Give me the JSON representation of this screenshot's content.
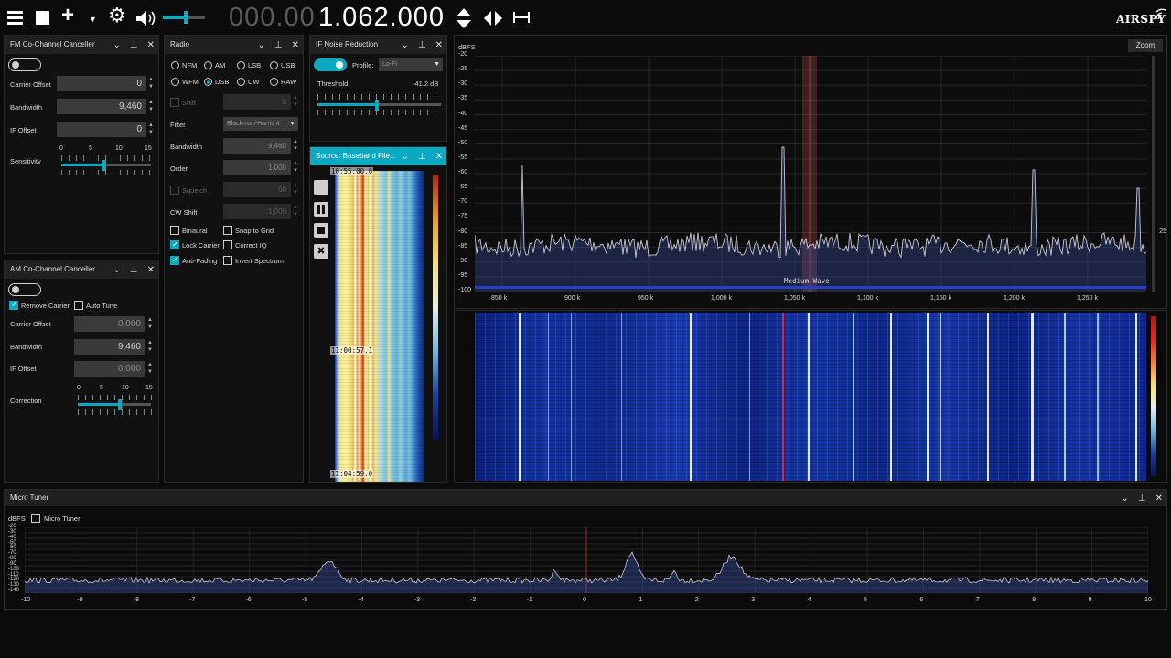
{
  "toolbar": {
    "freq_dim": "000.00",
    "freq_bright": "1.062.000",
    "brand": "AIRSPY",
    "volume_level": 0.55
  },
  "fm_cc": {
    "title": "FM Co-Channel Canceller",
    "carrier_offset_label": "Carrier Offset",
    "carrier_offset": "0",
    "bandwidth_label": "Bandwidth",
    "bandwidth": "9,460",
    "if_offset_label": "IF Offset",
    "if_offset": "0",
    "sensitivity_label": "Sensitivity",
    "ticks": [
      "0",
      "5",
      "10",
      "15"
    ],
    "sensitivity_value": 0.48
  },
  "am_cc": {
    "title": "AM Co-Channel Canceller",
    "remove_carrier": "Remove Carrier",
    "auto_tune": "Auto Tune",
    "carrier_offset_label": "Carrier Offset",
    "carrier_offset": "0.000",
    "bandwidth_label": "Bandwidth",
    "bandwidth": "9,460",
    "if_offset_label": "IF Offset",
    "if_offset": "0.000",
    "correction_label": "Correction",
    "ticks": [
      "0",
      "5",
      "10",
      "15"
    ],
    "correction_value": 0.57
  },
  "radio": {
    "title": "Radio",
    "modes": [
      "NFM",
      "AM",
      "LSB",
      "USB",
      "WFM",
      "DSB",
      "CW",
      "RAW"
    ],
    "selected_mode": "DSB",
    "shift_label": "Shift",
    "shift": "0",
    "filter_label": "Filter",
    "filter": "Blackman-Harris 4",
    "bandwidth_label": "Bandwidth",
    "bandwidth": "9,460",
    "order_label": "Order",
    "order": "1,000",
    "squelch_label": "Squelch",
    "squelch": "50",
    "cwshift_label": "CW Shift",
    "cwshift": "1,000",
    "binaural": "Binaural",
    "snap_to_grid": "Snap to Grid",
    "lock_carrier": "Lock Carrier",
    "correct_iq": "Correct IQ",
    "anti_fading": "Anti-Fading",
    "invert_spectrum": "Invert Spectrum"
  },
  "ifnr": {
    "title": "IF Noise Reduction",
    "profile_label": "Profile:",
    "profile": "Lo-Fi",
    "threshold_label": "Threshold",
    "threshold": "-41.2 dB",
    "threshold_value": 0.48
  },
  "source": {
    "title": "Source: Baseband File...",
    "times": [
      "10:55:00.0",
      "11:00:57.1",
      "11:04:59.0"
    ]
  },
  "spectrum": {
    "ylabel": "dBFS",
    "zoom": "Zoom",
    "yticks": [
      "-20",
      "-25",
      "-30",
      "-35",
      "-40",
      "-45",
      "-50",
      "-55",
      "-60",
      "-65",
      "-70",
      "-75",
      "-80",
      "-85",
      "-90",
      "-95",
      "-100"
    ],
    "xticks": [
      "850 k",
      "900 k",
      "950 k",
      "1,000 k",
      "1,050 k",
      "1,100 k",
      "1,150 k",
      "1,200 k",
      "1,250 k"
    ],
    "band_label": "Medium Wave",
    "right_value": "25"
  },
  "micro": {
    "title": "Micro Tuner",
    "ylabel": "dBFS",
    "checkbox": "Micro Tuner",
    "yticks": [
      "-20",
      "-30",
      "-40",
      "-50",
      "-60",
      "-70",
      "-80",
      "-90",
      "-100",
      "-110",
      "-120",
      "-130",
      "-140"
    ],
    "xticks": [
      "-10",
      "-9",
      "-8",
      "-7",
      "-6",
      "-5",
      "-4",
      "-3",
      "-2",
      "-1",
      "0",
      "1",
      "2",
      "3",
      "4",
      "5",
      "6",
      "7",
      "8",
      "9",
      "10"
    ]
  },
  "colors": {
    "accent": "#0aa9c2",
    "trace": "#c8c8d0",
    "waterfall_bg": "#0a1a6a"
  }
}
